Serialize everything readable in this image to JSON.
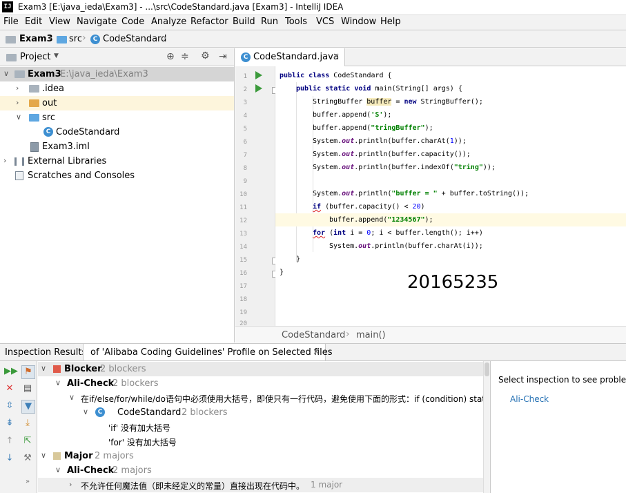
{
  "window": {
    "title": "Exam3 [E:\\java_ieda\\Exam3] - ...\\src\\CodeStandard.java [Exam3] - IntelliJ IDEA",
    "logo_text": "IJ"
  },
  "menu": [
    "File",
    "Edit",
    "View",
    "Navigate",
    "Code",
    "Analyze",
    "Refactor",
    "Build",
    "Run",
    "Tools",
    "VCS",
    "Window",
    "Help"
  ],
  "nav_breadcrumb": [
    "Exam3",
    "src",
    "CodeStandard"
  ],
  "project_panel": {
    "title": "Project",
    "tree": [
      {
        "label": "Exam3",
        "extra": "E:\\java_ieda\\Exam3",
        "icon": "module-folder-icon"
      },
      {
        "label": ".idea",
        "icon": "folder-icon"
      },
      {
        "label": "out",
        "icon": "excluded-folder-icon"
      },
      {
        "label": "src",
        "icon": "source-folder-icon"
      },
      {
        "label": "CodeStandard",
        "icon": "java-class-icon"
      },
      {
        "label": "Exam3.iml",
        "icon": "iml-file-icon"
      },
      {
        "label": "External Libraries",
        "icon": "libraries-icon"
      },
      {
        "label": "Scratches and Consoles",
        "icon": "scratches-icon"
      }
    ]
  },
  "editor": {
    "tab": "CodeStandard.java",
    "line_numbers": [
      "1",
      "2",
      "3",
      "4",
      "5",
      "6",
      "7",
      "8",
      "9",
      "10",
      "11",
      "12",
      "13",
      "14",
      "15",
      "16",
      "17",
      "18",
      "19",
      "20"
    ],
    "code": {
      "l1": {
        "kw1": "public",
        "kw2": "class",
        "rest": " CodeStandard {"
      },
      "l2": {
        "kw1": "public",
        "kw2": "static",
        "kw3": "void",
        "rest": " main(String[] args) {"
      },
      "l3": {
        "a": "StringBuffer ",
        "hl": "buffer",
        "b": " = ",
        "kw": "new",
        "c": " StringBuffer();"
      },
      "l4": {
        "a": "buffer.append(",
        "s": "'S'",
        "b": ");"
      },
      "l5": {
        "a": "buffer.append(",
        "s": "\"tringBuffer\"",
        "b": ");"
      },
      "l6": {
        "a": "System.",
        "f": "out",
        "b": ".println(buffer.charAt(",
        "n": "1",
        "c": "));"
      },
      "l7": {
        "a": "System.",
        "f": "out",
        "b": ".println(buffer.capacity());"
      },
      "l8": {
        "a": "System.",
        "f": "out",
        "b": ".println(buffer.indexOf(",
        "s": "\"tring\"",
        "c": "));"
      },
      "l10": {
        "a": "System.",
        "f": "out",
        "b": ".println(",
        "s": "\"buffer = \"",
        "c": " + buffer.toString());"
      },
      "l11": {
        "kw": "if",
        "a": " (buffer.capacity() < ",
        "n": "20",
        "b": ")"
      },
      "l12": {
        "a": "buffer.append(",
        "s": "\"1234567\"",
        "b": ");"
      },
      "l13": {
        "kw": "for",
        "a": " (",
        "kw2": "int",
        "b": " i = ",
        "n": "0",
        "c": "; i < buffer.length(); i++)"
      },
      "l14": {
        "a": "System.",
        "f": "out",
        "b": ".println(buffer.charAt(i));"
      },
      "l15": "}",
      "l16": "}"
    },
    "watermark": "20165235",
    "breadcrumb": [
      "CodeStandard",
      "main()"
    ]
  },
  "inspection": {
    "label": "Inspection Results:",
    "tab": "of 'Alibaba Coding Guidelines' Profile on Selected files",
    "rows": [
      {
        "label": "Blocker",
        "count": "2 blockers"
      },
      {
        "label": "Ali-Check",
        "count": "2 blockers"
      },
      {
        "label": "在if/else/for/while/do语句中必须使用大括号，即使只有一行代码，避免使用下面的形式：if (condition) statem"
      },
      {
        "label": "CodeStandard",
        "count": "2 blockers"
      },
      {
        "label": "'if' 没有加大括号"
      },
      {
        "label": "'for' 没有加大括号"
      },
      {
        "label": "Major",
        "count": "2 majors"
      },
      {
        "label": "Ali-Check",
        "count": "2 majors"
      },
      {
        "label": "不允许任何魔法值（即未经定义的常量）直接出现在代码中。",
        "count": "1 major"
      }
    ],
    "detail_text": "Select inspection to see problem",
    "detail_link": "Ali-Check"
  },
  "colors": {
    "keyword": "#000080",
    "string": "#008000",
    "field": "#660e7a",
    "number": "#0000ff",
    "run_icon": "#3b9a3b"
  }
}
